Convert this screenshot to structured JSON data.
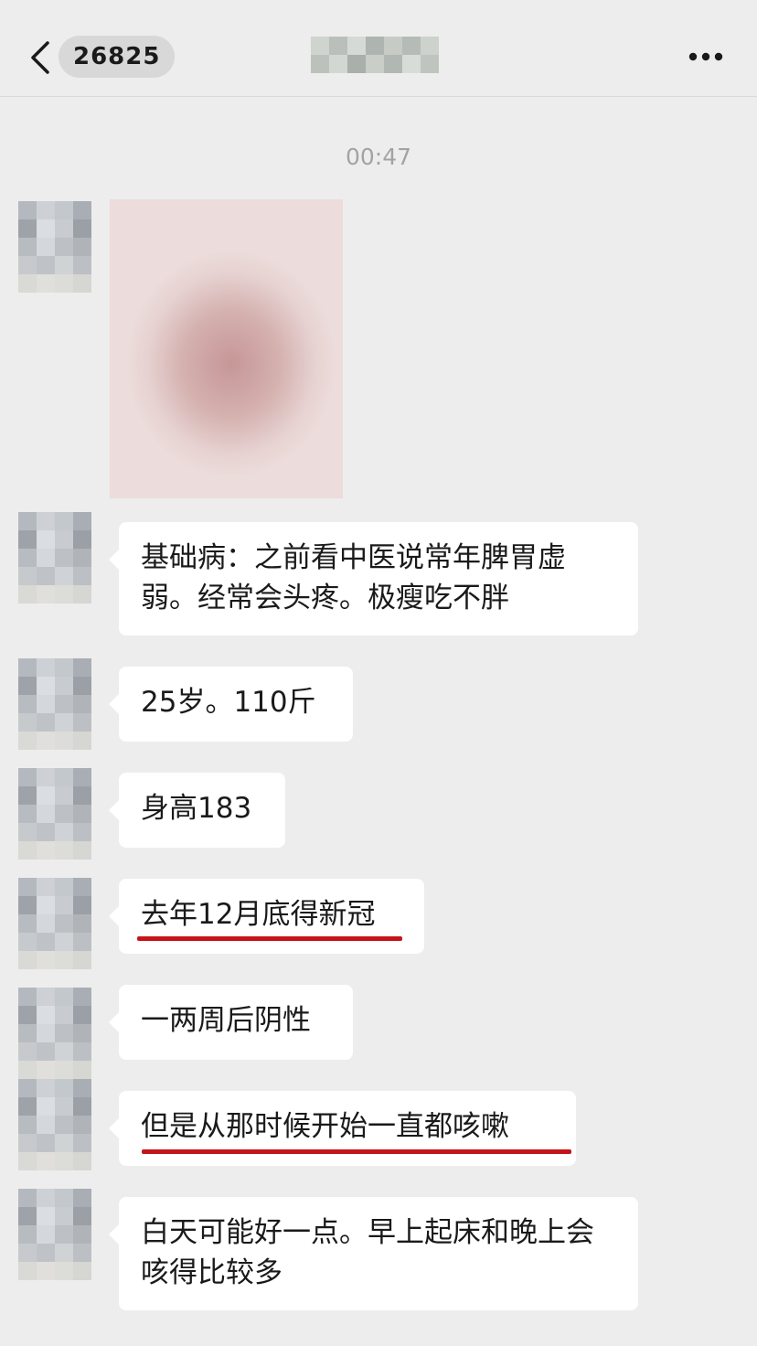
{
  "header": {
    "unread_count": "26825",
    "back_icon": "chevron-left-icon",
    "more_icon": "ellipsis-icon"
  },
  "timestamp": "00:47",
  "messages": [
    {
      "type": "image"
    },
    {
      "type": "text",
      "text": "基础病：之前看中医说常年脾胃虚弱。经常会头疼。极瘦吃不胖"
    },
    {
      "type": "text",
      "text": "25岁。110斤"
    },
    {
      "type": "text",
      "text": "身高183"
    },
    {
      "type": "text",
      "text": "去年12月底得新冠",
      "highlighted": true
    },
    {
      "type": "text",
      "text": "一两周后阴性"
    },
    {
      "type": "text",
      "text": "但是从那时候开始一直都咳嗽",
      "highlighted": true
    },
    {
      "type": "text",
      "text": "白天可能好一点。早上起床和晚上会咳得比较多"
    }
  ],
  "colors": {
    "background": "#ededed",
    "bubble": "#ffffff",
    "underline": "#c4141a",
    "timestamp": "#a3a3a3"
  }
}
